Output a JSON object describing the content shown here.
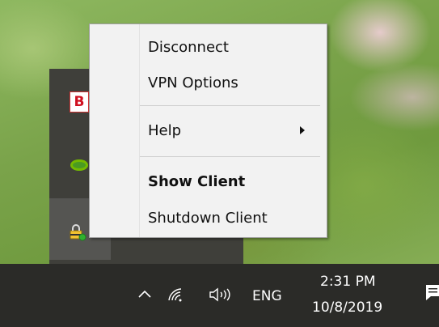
{
  "menu": {
    "items": [
      {
        "label": "Disconnect",
        "bold": false
      },
      {
        "label": "VPN Options",
        "bold": false
      },
      {
        "label": "Help",
        "bold": false,
        "has_submenu": true
      },
      {
        "label": "Show Client",
        "bold": true
      },
      {
        "label": "Shutdown Client",
        "bold": false
      }
    ]
  },
  "tray_overflow": {
    "icons": [
      "b-app-icon",
      "nvidia-icon",
      "vpn-client-icon"
    ],
    "selected": "vpn-client-icon"
  },
  "taskbar": {
    "language": "ENG",
    "time": "2:31 PM",
    "date": "10/8/2019",
    "icons": [
      "chevron-up-icon",
      "wifi-icon",
      "volume-icon",
      "notifications-icon"
    ]
  },
  "colors": {
    "menu_bg": "#f2f2f2",
    "taskbar_bg": "#2b2b28",
    "tray_bg": "#3f3f3a",
    "b_icon_red": "#d01020",
    "nvidia_green": "#76b900",
    "status_green": "#2fb12f"
  }
}
